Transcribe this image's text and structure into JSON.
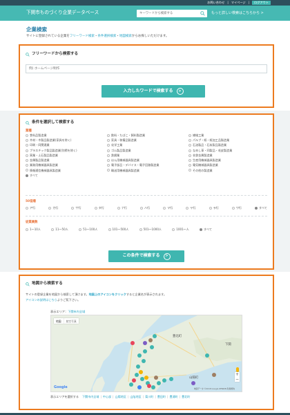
{
  "topbar": {
    "links": [
      "お問い合わせ",
      "マイページ",
      "ログアウト"
    ]
  },
  "header": {
    "site_title": "下関市ものづくり企業データベース",
    "search_placeholder": "キーワードから検索する",
    "detail_link": "もっと詳しい検索はこちらから >"
  },
  "page": {
    "title": "企業検索",
    "intro": {
      "prefix": "サイトに登録されている企業を",
      "link1": "フリーワード検索",
      "sep1": "・",
      "link2": "条件選択検索",
      "sep2": "・",
      "link3": "地図検索",
      "suffix": "からお探しいただけます。"
    }
  },
  "freeword": {
    "title": "フリーワードから検索する",
    "placeholder": "例) ホームページ制作",
    "button": "入力したワードで検索する"
  },
  "conditions": {
    "title": "条件を選択して検索する",
    "industry_label": "業種",
    "industries": [
      "食料品製造業",
      "飲料・たばこ・飼料製造業",
      "繊維工業",
      "木材・木製品製造業(家具を除く)",
      "家具・装備品製造業",
      "パルプ・紙・紙加工品製造業",
      "印刷・同関連業",
      "化学工業",
      "石油製品・石炭製品製造業",
      "プラスチック製品製造業(別掲を除く)",
      "ゴム製品製造業",
      "なめし革・同製品・毛皮製造業",
      "窯業・土石製品製造業",
      "鉄鋼業",
      "非鉄金属製造業",
      "金属製品製造業",
      "はん用機械器具製造業",
      "生産用機械器具製造業",
      "業務用機械器具製造業",
      "電子部品・デバイス・電子回路製造業",
      "電気機械器具製造業",
      "情報通信機械器具製造業",
      "輸送用機械器具製造業",
      "その他の製造業"
    ],
    "industry_all": "すべて",
    "area_label": "50音順",
    "areas": [
      "ア行",
      "カ行",
      "サ行",
      "タ行",
      "ナ行",
      "ハ行",
      "マ行",
      "ヤ行",
      "ラ行",
      "ワ行",
      "すべて"
    ],
    "employees_label": "従業員数",
    "employees": [
      "1〜10人",
      "11〜50人",
      "51〜100人",
      "101〜500人",
      "501〜1000人",
      "1001〜人",
      "すべて"
    ],
    "button": "この条件で検索する"
  },
  "map_search": {
    "title": "地図から検索する",
    "desc1_prefix": "サイトの登録企業を地図から検索して頂けます。",
    "desc1_highlight": "地図上のアイコンをクリック",
    "desc1_suffix": "すると企業名が表示されます。",
    "desc2_link": "アイコンの説明はこちら",
    "desc2_suffix": "よりご覧下さい。",
    "area_prefix": "表示エリア：",
    "area_value": "下関市内全域",
    "map_tabs": [
      "地図",
      "航空写真"
    ],
    "place_names": [
      "豊北町",
      "山陽町",
      "下関"
    ],
    "google": "Google",
    "attribution": "地図データ ©2018 Google ZENRIN 利用規約",
    "area_links_lead": "表示エリアを選択する",
    "area_links": [
      "下関市内全域",
      "中心部",
      "山陽地区",
      "山陰地区",
      "菊川町",
      "豊田町",
      "豊浦町",
      "豊北町"
    ]
  },
  "colors": {
    "accent": "#46b9b3",
    "highlight_border": "#ec7a1e",
    "topbar": "#2d4f5c"
  }
}
